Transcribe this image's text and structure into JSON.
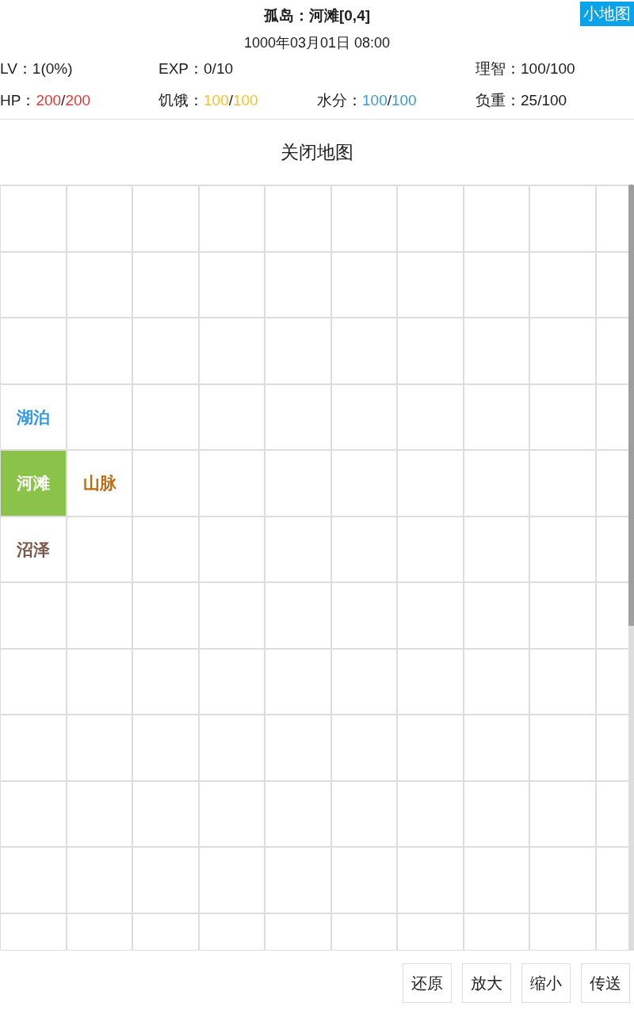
{
  "header": {
    "title": "孤岛：河滩[0,4]",
    "minimap_button": "小地图",
    "datetime": "1000年03月01日 08:00"
  },
  "stat_rows": [
    [
      {
        "label": "LV：",
        "value": [
          "1(0%)"
        ]
      },
      {
        "label": "EXP：",
        "value": [
          "0/10"
        ]
      },
      {
        "label": "理智：",
        "value": [
          "100/100"
        ]
      }
    ],
    [
      {
        "label": "HP：",
        "value": [
          "200",
          "/",
          "200"
        ],
        "color": "#e53935"
      },
      {
        "label": "饥饿：",
        "value": [
          "100",
          "/",
          "100"
        ],
        "color": "#fbc02d"
      },
      {
        "label": "水分：",
        "value": [
          "100",
          "/",
          "100"
        ],
        "color": "#3a9ad9"
      },
      {
        "label": "负重：",
        "value": [
          "25/100"
        ]
      }
    ]
  ],
  "close_map_button": "关闭地图",
  "map": {
    "rows": [
      {
        "cells": [
          {
            "selected": false
          },
          {
            "selected": false
          },
          {
            "selected": false
          },
          {
            "selected": false
          },
          {
            "selected": false
          },
          {
            "selected": false
          },
          {
            "selected": false
          },
          {
            "selected": false
          },
          {
            "selected": false
          },
          {
            "selected": false
          }
        ]
      },
      {
        "cells": [
          {
            "selected": false
          },
          {
            "selected": false
          },
          {
            "selected": false
          },
          {
            "selected": false
          },
          {
            "selected": false
          },
          {
            "selected": false
          },
          {
            "selected": false
          },
          {
            "selected": false
          },
          {
            "selected": false
          },
          {
            "selected": false
          }
        ]
      },
      {
        "cells": [
          {
            "selected": false
          },
          {
            "selected": false
          },
          {
            "selected": false
          },
          {
            "selected": false
          },
          {
            "selected": false
          },
          {
            "selected": false
          },
          {
            "selected": false
          },
          {
            "selected": false
          },
          {
            "selected": false
          },
          {
            "selected": false
          }
        ]
      },
      {
        "cells": [
          {
            "label": "湖泊",
            "color": "#2f96e3",
            "selected": false
          },
          {
            "selected": false
          },
          {
            "selected": false
          },
          {
            "selected": false
          },
          {
            "selected": false
          },
          {
            "selected": false
          },
          {
            "selected": false
          },
          {
            "selected": false
          },
          {
            "selected": false
          },
          {
            "selected": false
          }
        ]
      },
      {
        "cells": [
          {
            "label": "河滩",
            "color": "#8bc34a",
            "selected": true
          },
          {
            "label": "山脉",
            "color": "#c0680c",
            "selected": false
          },
          {
            "selected": false
          },
          {
            "selected": false
          },
          {
            "selected": false
          },
          {
            "selected": false
          },
          {
            "selected": false
          },
          {
            "selected": false
          },
          {
            "selected": false
          },
          {
            "selected": false
          }
        ]
      },
      {
        "cells": [
          {
            "label": "沼泽",
            "color": "#795548",
            "selected": false
          },
          {
            "selected": false
          },
          {
            "selected": false
          },
          {
            "selected": false
          },
          {
            "selected": false
          },
          {
            "selected": false
          },
          {
            "selected": false
          },
          {
            "selected": false
          },
          {
            "selected": false
          },
          {
            "selected": false
          }
        ]
      },
      {
        "cells": [
          {
            "selected": false
          },
          {
            "selected": false
          },
          {
            "selected": false
          },
          {
            "selected": false
          },
          {
            "selected": false
          },
          {
            "selected": false
          },
          {
            "selected": false
          },
          {
            "selected": false
          },
          {
            "selected": false
          },
          {
            "selected": false
          }
        ]
      },
      {
        "cells": [
          {
            "selected": false
          },
          {
            "selected": false
          },
          {
            "selected": false
          },
          {
            "selected": false
          },
          {
            "selected": false
          },
          {
            "selected": false
          },
          {
            "selected": false
          },
          {
            "selected": false
          },
          {
            "selected": false
          },
          {
            "selected": false
          }
        ]
      },
      {
        "cells": [
          {
            "selected": false
          },
          {
            "selected": false
          },
          {
            "selected": false
          },
          {
            "selected": false
          },
          {
            "selected": false
          },
          {
            "selected": false
          },
          {
            "selected": false
          },
          {
            "selected": false
          },
          {
            "selected": false
          },
          {
            "selected": false
          }
        ]
      },
      {
        "cells": [
          {
            "selected": false
          },
          {
            "selected": false
          },
          {
            "selected": false
          },
          {
            "selected": false
          },
          {
            "selected": false
          },
          {
            "selected": false
          },
          {
            "selected": false
          },
          {
            "selected": false
          },
          {
            "selected": false
          },
          {
            "selected": false
          }
        ]
      },
      {
        "cells": [
          {
            "selected": false
          },
          {
            "selected": false
          },
          {
            "selected": false
          },
          {
            "selected": false
          },
          {
            "selected": false
          },
          {
            "selected": false
          },
          {
            "selected": false
          },
          {
            "selected": false
          },
          {
            "selected": false
          },
          {
            "selected": false
          }
        ]
      },
      {
        "cells": [
          {
            "selected": false
          },
          {
            "selected": false
          },
          {
            "selected": false
          },
          {
            "selected": false
          },
          {
            "selected": false
          },
          {
            "selected": false
          },
          {
            "selected": false
          },
          {
            "selected": false
          },
          {
            "selected": false
          },
          {
            "selected": false
          }
        ]
      }
    ]
  },
  "buttons": [
    "还原",
    "放大",
    "缩小",
    "传送"
  ]
}
